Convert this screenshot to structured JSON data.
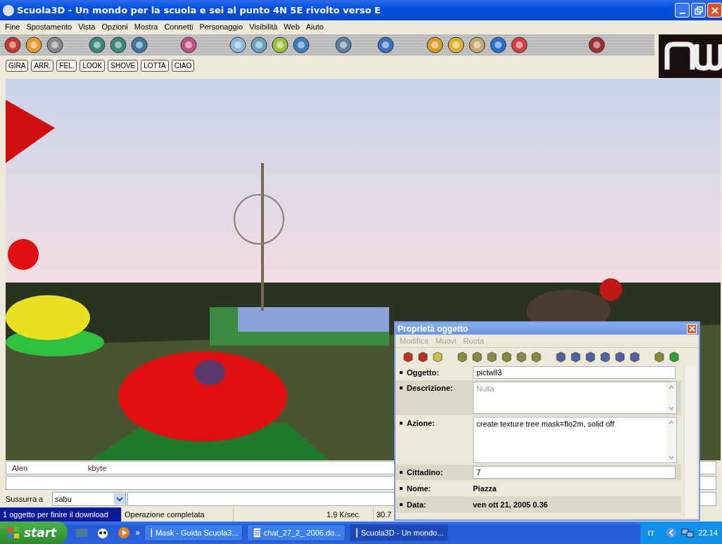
{
  "window": {
    "title": "Scuola3D - Un mondo per la scuola e sei al punto 4N 5E rivolto verso E"
  },
  "menu": [
    "Fine",
    "Spostamento",
    "Vista",
    "Opzioni",
    "Mostra",
    "Connetti",
    "Personaggio",
    "Visibilità",
    "Web",
    "Aiuto"
  ],
  "gesture_buttons": [
    "GIRA",
    "ARR.",
    "FEL.",
    "LOOK",
    "SHOVE",
    "LOTTA",
    "CIAO"
  ],
  "chat_list": {
    "column_1": "Alen",
    "column_2": "kbyte"
  },
  "whisper": {
    "label": "Sussurra a",
    "value": "sabu"
  },
  "status_bar": [
    "1 oggetto per finire il download",
    "Operazione completata",
    "1.9 K/sec",
    "30.7"
  ],
  "dialog": {
    "title": "Proprietà oggetto",
    "menu": [
      {
        "label": "Modifica",
        "disabled": true
      },
      {
        "label": "Muovi",
        "disabled": true
      },
      {
        "label": "Ruota",
        "disabled": true
      }
    ],
    "fields": [
      {
        "kind": "input",
        "label": "Oggetto:",
        "value": "pictwll3"
      },
      {
        "kind": "textarea",
        "label": "Descrizione:",
        "placeholder": "Nulla"
      },
      {
        "kind": "textarea",
        "label": "Azione:",
        "value": "create texture tree mask=flo2m, solid off"
      },
      {
        "kind": "input",
        "label": "Cittadino:",
        "value": "7"
      },
      {
        "kind": "static",
        "label": "Nome:",
        "value": "Piazza"
      },
      {
        "kind": "static",
        "label": "Data:",
        "value": "ven ott 21, 2005 0.36"
      }
    ]
  },
  "taskbar": {
    "start": "start",
    "more": "»",
    "tasks": [
      {
        "label": "Mask - Guida Scuola3...",
        "selected": false
      },
      {
        "label": "chat_27_2_ 2006.do...",
        "selected": false
      },
      {
        "label": "Scuola3D - Un mondo...",
        "selected": true
      }
    ],
    "language": "IT",
    "clock": "22.14"
  }
}
